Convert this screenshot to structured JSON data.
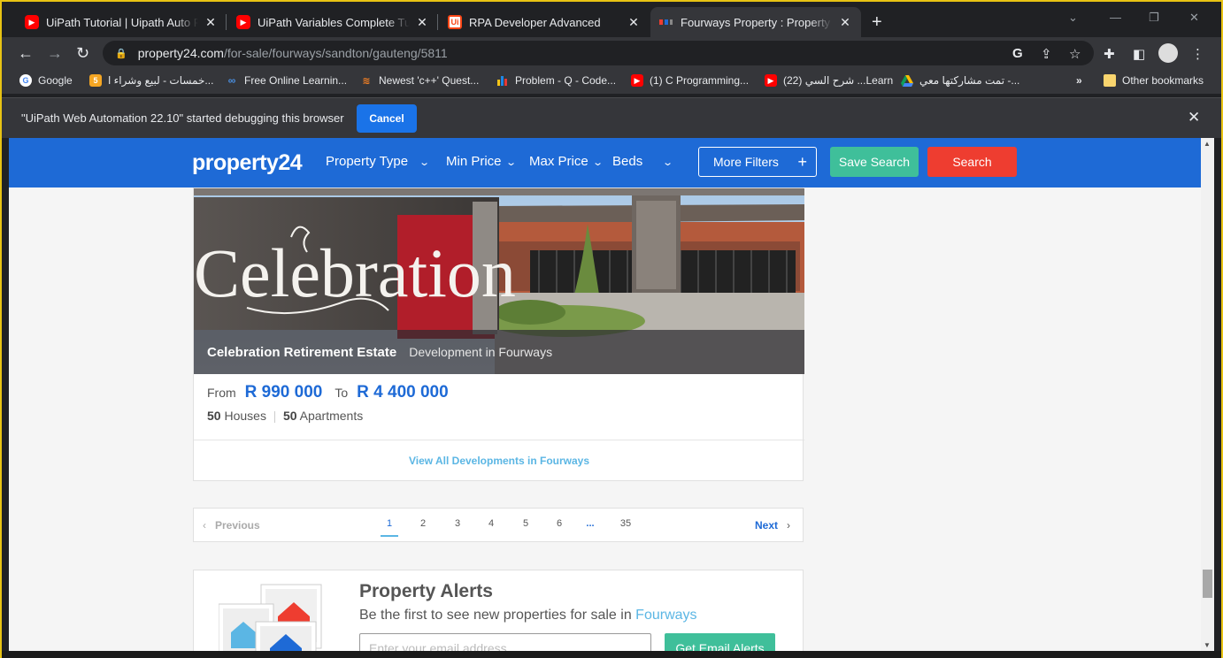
{
  "tabs": [
    {
      "title": "UiPath Tutorial | Uipath Auto Fill I",
      "favicon": "youtube-icon"
    },
    {
      "title": "UiPath Variables Complete Tutori",
      "favicon": "youtube-icon"
    },
    {
      "title": "RPA Developer Advanced",
      "favicon": "uipath-icon"
    },
    {
      "title": "Fourways Property : Property and",
      "favicon": "property24-icon"
    }
  ],
  "address": {
    "domain": "property24.com",
    "path": "/for-sale/fourways/sandton/gauteng/5811"
  },
  "bookmarks": [
    {
      "label": "Google",
      "icon": "google-icon"
    },
    {
      "label": "خمسات - لبيع وشراء ا...",
      "icon": "khamsat-icon"
    },
    {
      "label": "Free Online Learnin...",
      "icon": "coursera-icon"
    },
    {
      "label": "Newest 'c++' Quest...",
      "icon": "stackoverflow-icon"
    },
    {
      "label": "Problem - Q - Code...",
      "icon": "codeforces-icon"
    },
    {
      "label": "(1) C Programming...",
      "icon": "youtube-icon"
    },
    {
      "label": "(22) شرح السي ...Learn",
      "icon": "youtube-icon"
    },
    {
      "label": "تمت مشاركتها معي -...",
      "icon": "drive-icon"
    }
  ],
  "bookmarks_more": "»",
  "other_bookmarks": "Other bookmarks",
  "debug_bar": {
    "message": "\"UiPath Web Automation 22.10\" started debugging this browser",
    "cancel": "Cancel"
  },
  "site": {
    "logo": "property24",
    "filters": [
      "Property Type",
      "Min Price",
      "Max Price",
      "Beds"
    ],
    "more_filters": "More Filters",
    "save_search": "Save Search",
    "search": "Search"
  },
  "development": {
    "name": "Celebration Retirement Estate",
    "subtitle": "Development in Fourways",
    "sign_text": "Celebration",
    "from_label": "From",
    "from_price": "R 990 000",
    "to_label": "To",
    "to_price": "R 4 400 000",
    "houses_count": "50",
    "houses_label": "Houses",
    "apartments_count": "50",
    "apartments_label": "Apartments",
    "view_all": "View All Developments in Fourways"
  },
  "pagination": {
    "previous": "Previous",
    "pages": [
      "1",
      "2",
      "3",
      "4",
      "5",
      "6",
      "...",
      "35"
    ],
    "current": "1",
    "next": "Next"
  },
  "alerts": {
    "title": "Property Alerts",
    "description": "Be the first to see new properties for sale in",
    "location": "Fourways",
    "email_placeholder": "Enter your email address",
    "button": "Get Email Alerts"
  },
  "colors": {
    "brand_blue": "#1e6ad6",
    "save_green": "#3fbf9a",
    "search_red": "#ee3d30",
    "link_blue": "#5bb6e4"
  }
}
